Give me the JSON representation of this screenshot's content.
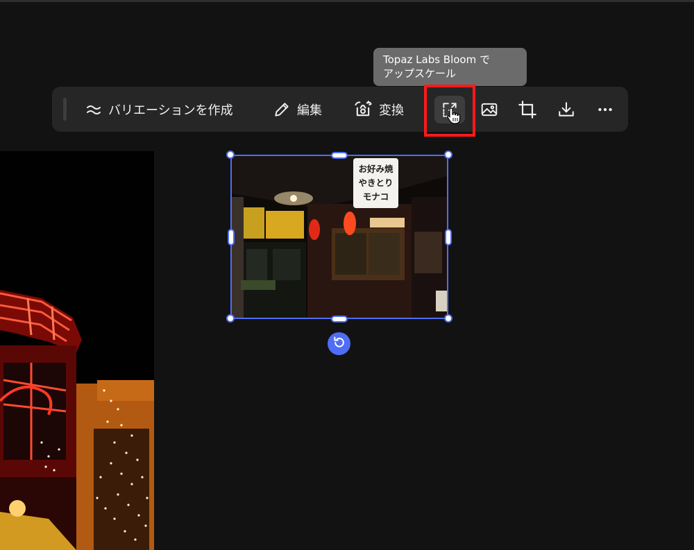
{
  "tooltip": {
    "line1": "Topaz Labs Bloom で",
    "line2": "アップスケール"
  },
  "toolbar": {
    "variation_label": "バリエーションを作成",
    "edit_label": "編集",
    "transform_label": "変換"
  },
  "signboard": {
    "line1": "お好み焼",
    "line2": "やきとり",
    "line3": "モナコ"
  },
  "icons": {
    "variation": "approx-icon",
    "edit": "pencil-icon",
    "transform": "transform-icon",
    "upscale": "upscale-icon",
    "image": "image-icon",
    "crop": "crop-icon",
    "download": "download-icon",
    "more": "more-icon",
    "rotate": "rotate-icon",
    "cursor": "hand-pointer-icon"
  },
  "colors": {
    "toolbar_bg": "#262626",
    "tooltip_bg": "#6b6b6b",
    "selection": "#4f6df5",
    "highlight": "#ff1a1a"
  }
}
